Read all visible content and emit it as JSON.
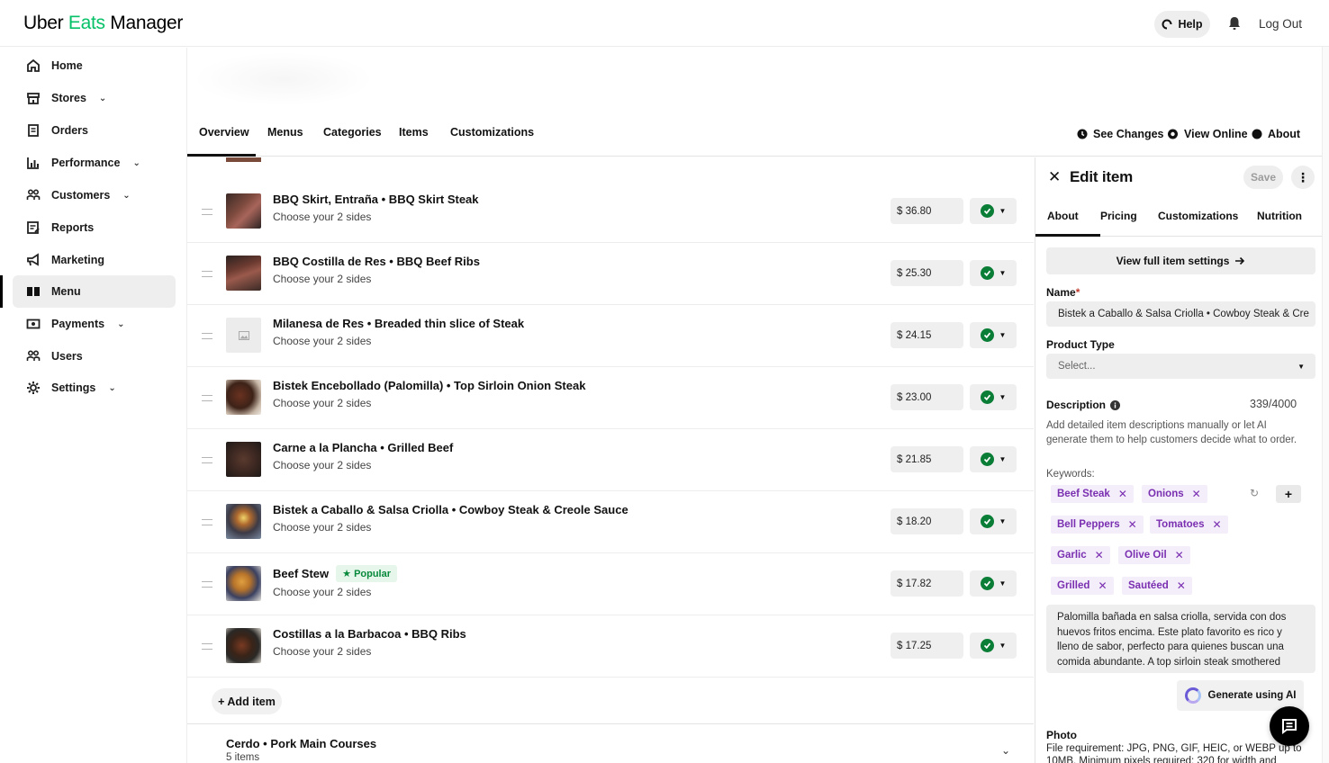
{
  "brand": {
    "part1": "Uber",
    "part2": "Eats",
    "part3": "Manager",
    "accent": "#06c167"
  },
  "topbar": {
    "help_label": "Help",
    "logout_label": "Log Out"
  },
  "sidebar": {
    "items": [
      {
        "label": "Home",
        "icon": "home-icon"
      },
      {
        "label": "Stores",
        "icon": "store-icon",
        "expandable": true
      },
      {
        "label": "Orders",
        "icon": "receipt-icon"
      },
      {
        "label": "Performance",
        "icon": "chart-icon",
        "expandable": true
      },
      {
        "label": "Customers",
        "icon": "customers-icon",
        "expandable": true
      },
      {
        "label": "Reports",
        "icon": "report-icon"
      },
      {
        "label": "Marketing",
        "icon": "megaphone-icon"
      },
      {
        "label": "Menu",
        "icon": "book-icon",
        "active": true
      },
      {
        "label": "Payments",
        "icon": "payment-icon",
        "expandable": true
      },
      {
        "label": "Users",
        "icon": "users-icon"
      },
      {
        "label": "Settings",
        "icon": "gear-icon",
        "expandable": true
      }
    ]
  },
  "tabs": {
    "items": [
      "Overview",
      "Menus",
      "Categories",
      "Items",
      "Customizations"
    ],
    "active": "Overview",
    "see_changes": "See Changes",
    "view_online": "View Online",
    "about": "About"
  },
  "items": [
    {
      "name": "BBQ Skirt, Entraña • BBQ Skirt Steak",
      "sub": "Choose your 2 sides",
      "price": "$  36.80",
      "available": true
    },
    {
      "name": "BBQ Costilla de Res • BBQ Beef Ribs",
      "sub": "Choose your 2 sides",
      "price": "$  25.30",
      "available": true
    },
    {
      "name": "Milanesa de Res • Breaded thin slice of Steak",
      "sub": "Choose your 2 sides",
      "price": "$  24.15",
      "available": true,
      "no_photo": true
    },
    {
      "name": "Bistek Encebollado (Palomilla) • Top Sirloin Onion Steak",
      "sub": "Choose your 2 sides",
      "price": "$  23.00",
      "available": true
    },
    {
      "name": "Carne a la Plancha • Grilled Beef",
      "sub": "Choose your 2 sides",
      "price": "$  21.85",
      "available": true
    },
    {
      "name": "Bistek a Caballo & Salsa Criolla • Cowboy Steak & Creole Sauce",
      "sub": "Choose your 2 sides",
      "price": "$  18.20",
      "available": true
    },
    {
      "name": "Beef Stew",
      "sub": "Choose your 2 sides",
      "price": "$  17.82",
      "available": true,
      "badge": "Popular"
    },
    {
      "name": "Costillas a la Barbacoa • BBQ Ribs",
      "sub": "Choose your 2 sides",
      "price": "$  17.25",
      "available": true
    }
  ],
  "add_item_label": "+ Add item",
  "next_group": {
    "title": "Cerdo • Pork Main Courses",
    "count": "5 items"
  },
  "panel": {
    "title": "Edit item",
    "save_label": "Save",
    "tabs": [
      "About",
      "Pricing",
      "Customizations",
      "Nutrition"
    ],
    "active_tab": "About",
    "full_settings_label": "View full item settings",
    "name_label": "Name",
    "name_value": "Bistek a Caballo & Salsa Criolla • Cowboy Steak & Cre",
    "product_type_label": "Product Type",
    "product_type_placeholder": "Select...",
    "description_label": "Description",
    "description_counter": "339/4000",
    "description_help": "Add detailed item descriptions manually or let AI generate them to help customers decide what to order.",
    "keywords_label": "Keywords:",
    "keywords": [
      "Beef Steak",
      "Onions",
      "Bell Peppers",
      "Tomatoes",
      "Garlic",
      "Olive Oil",
      "Grilled",
      "Sautéed"
    ],
    "description_text": "Palomilla bañada en salsa criolla, servida con dos huevos fritos encima. Este plato favorito es rico y lleno de sabor, perfecto para quienes buscan una comida abundante. A top sirloin steak smothered",
    "generate_ai_label": "Generate using AI",
    "photo_label": "Photo",
    "photo_requirements": "File requirement: JPG, PNG, GIF, HEIC, or WEBP up to 10MB. Minimum pixels required: 320 for width and"
  },
  "colors": {
    "check_green": "#0a7d36",
    "keyword_purple": "#7a2fb0",
    "popular_green": "#08893c"
  }
}
